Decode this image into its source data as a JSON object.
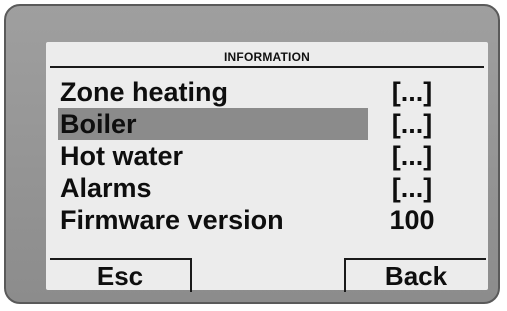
{
  "screen": {
    "title": "INFORMATION",
    "items": [
      {
        "label": "Zone heating",
        "value": "[...]",
        "selected": false
      },
      {
        "label": "Boiler",
        "value": "[...]",
        "selected": true
      },
      {
        "label": "Hot water",
        "value": "[...]",
        "selected": false
      },
      {
        "label": "Alarms",
        "value": "[...]",
        "selected": false
      },
      {
        "label": "Firmware version",
        "value": "100",
        "selected": false
      }
    ],
    "softkeys": {
      "left": "Esc",
      "right": "Back"
    }
  },
  "colors": {
    "bezel": "#9a9a9a",
    "lcd_background": "#ececec",
    "selection_highlight": "#8b8b8b",
    "text": "#0e0e0e"
  }
}
